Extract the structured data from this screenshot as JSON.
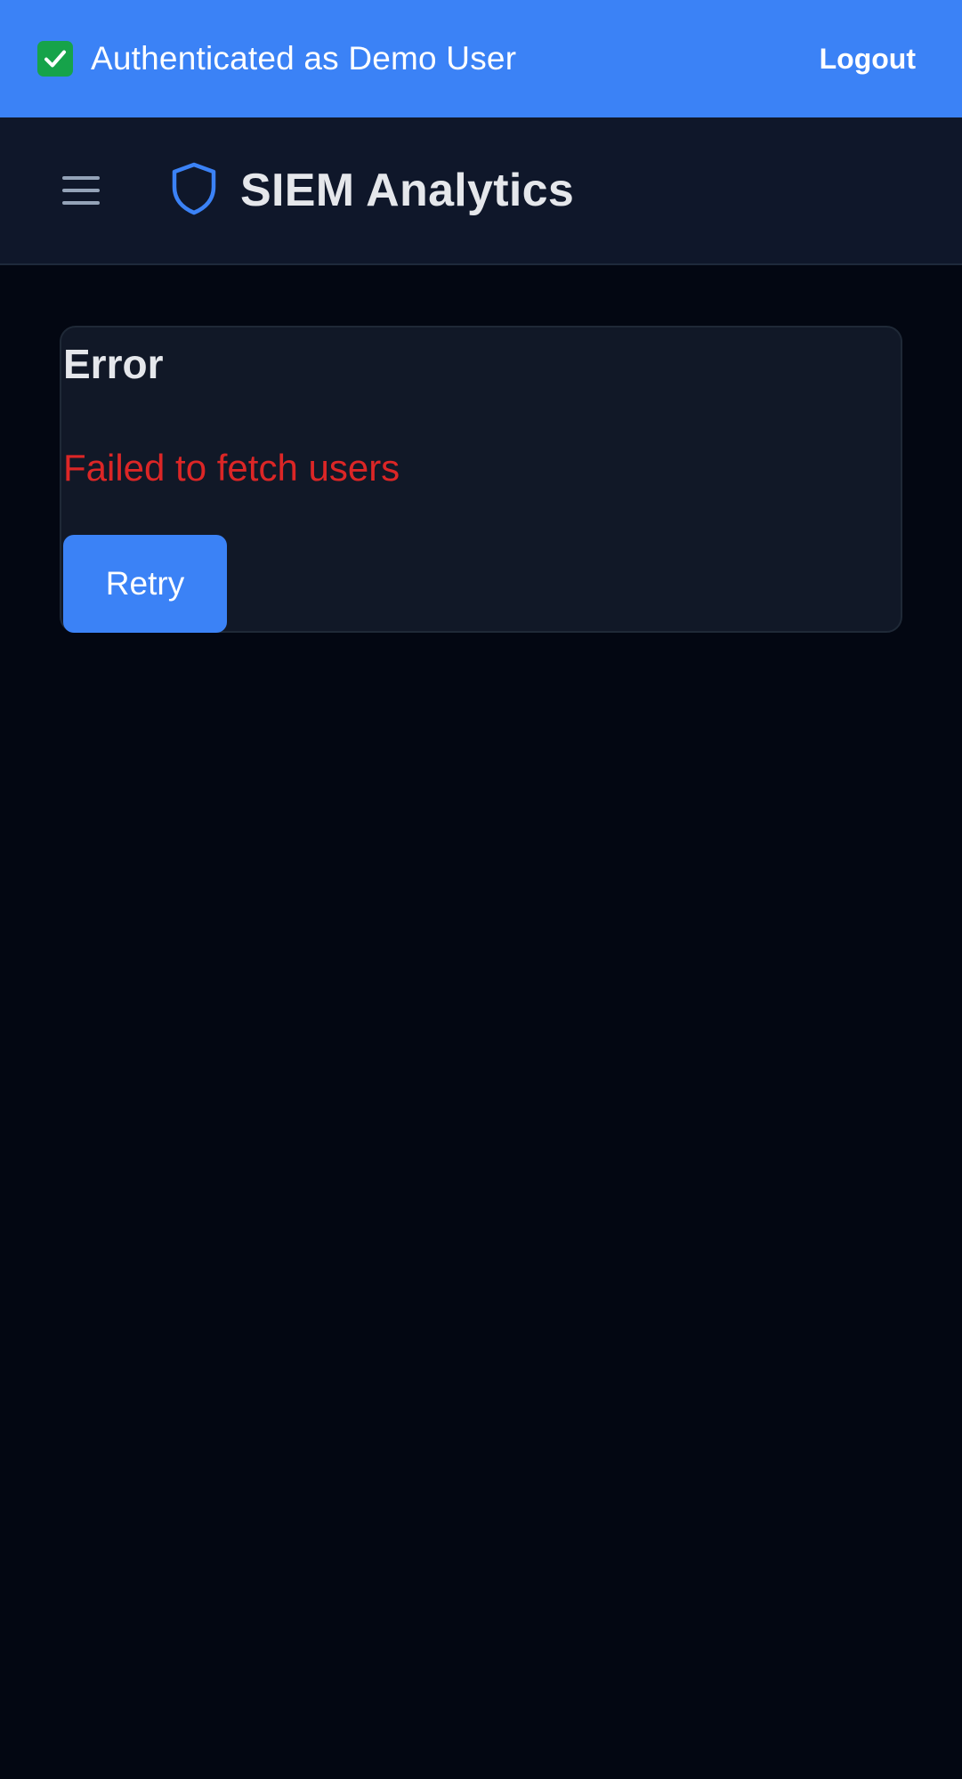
{
  "auth_bar": {
    "status_icon": "check-icon",
    "status_text": "Authenticated as Demo User",
    "logout_label": "Logout",
    "background_color": "#3b82f6"
  },
  "header": {
    "menu_icon": "hamburger-menu-icon",
    "logo_icon": "shield-icon",
    "title": "SIEM Analytics",
    "accent_color": "#3b82f6"
  },
  "error_card": {
    "title": "Error",
    "message": "Failed to fetch users",
    "message_color": "#dc2626",
    "retry_label": "Retry"
  }
}
